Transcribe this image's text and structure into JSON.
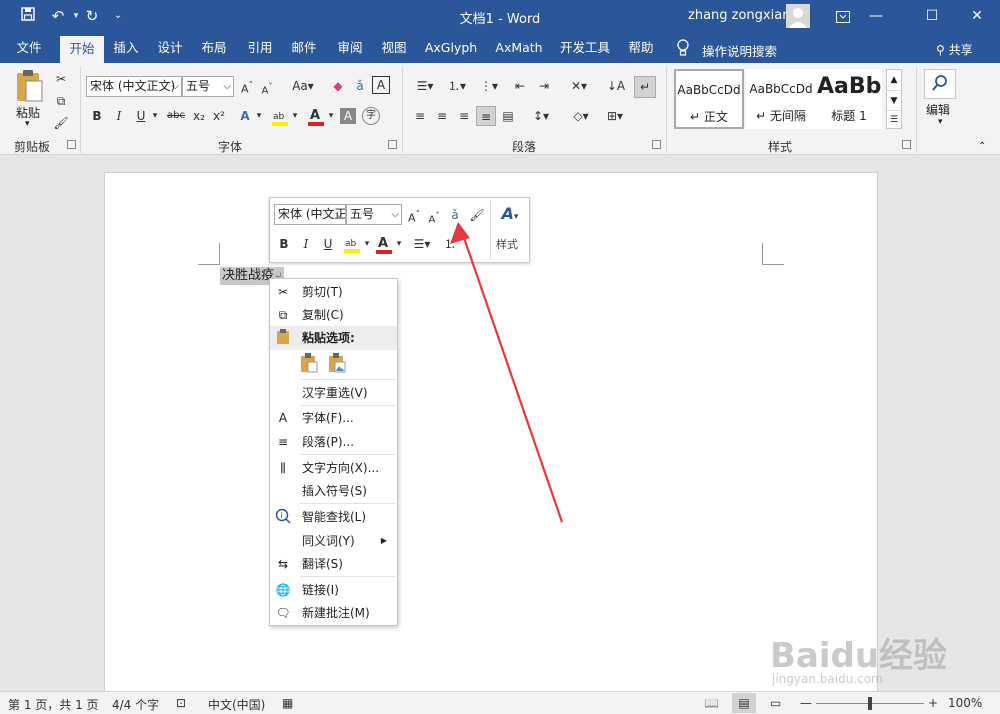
{
  "titlebar": {
    "doc_title": "文档1 - Word",
    "user_name": "zhang zongxian",
    "qa_save": "save-icon",
    "qa_undo": "undo-icon",
    "qa_redo": "redo-icon",
    "qa_more": "customize-icon"
  },
  "tabs": [
    {
      "label": "文件"
    },
    {
      "label": "开始"
    },
    {
      "label": "插入"
    },
    {
      "label": "设计"
    },
    {
      "label": "布局"
    },
    {
      "label": "引用"
    },
    {
      "label": "邮件"
    },
    {
      "label": "审阅"
    },
    {
      "label": "视图"
    },
    {
      "label": "AxGlyph"
    },
    {
      "label": "AxMath"
    },
    {
      "label": "开发工具"
    },
    {
      "label": "帮助"
    }
  ],
  "tell_me": "操作说明搜索",
  "share": "共享",
  "ribbon": {
    "clipboard": {
      "label": "剪贴板",
      "paste": "粘贴"
    },
    "font": {
      "label": "字体",
      "font_name": "宋体 (中文正文)",
      "font_size": "五号",
      "change_case": "Aa",
      "bold": "B",
      "italic": "I",
      "underline": "U",
      "strike": "abc",
      "sub": "x₂",
      "sup": "x²"
    },
    "paragraph": {
      "label": "段落"
    },
    "styles": {
      "label": "样式",
      "items": [
        {
          "sample": "AaBbCcDd",
          "name": "正文"
        },
        {
          "sample": "AaBbCcDd",
          "name": "无间隔"
        },
        {
          "sample": "AaBb",
          "name": "标题 1"
        }
      ]
    },
    "editing": {
      "label": "编辑"
    }
  },
  "document": {
    "selected_text": "决胜战疫"
  },
  "minitoolbar": {
    "font_name": "宋体 (中文正文)",
    "font_size": "五号",
    "bold": "B",
    "italic": "I",
    "underline": "U",
    "styles": "样式"
  },
  "context_menu": {
    "cut": "剪切(T)",
    "copy": "复制(C)",
    "paste_options": "粘贴选项:",
    "reconvert": "汉字重选(V)",
    "font": "字体(F)...",
    "paragraph": "段落(P)...",
    "text_direction": "文字方向(X)...",
    "insert_symbol": "插入符号(S)",
    "smart_lookup": "智能查找(L)",
    "synonyms": "同义词(Y)",
    "translate": "翻译(S)",
    "link": "链接(I)",
    "new_comment": "新建批注(M)"
  },
  "statusbar": {
    "page": "第 1 页，共 1 页",
    "words": "4/4 个字",
    "language": "中文(中国)",
    "zoom": "100%",
    "zoom_level": 1.0
  },
  "watermark": {
    "brand": "Baidu经验",
    "url": "jingyan.baidu.com"
  },
  "colors": {
    "accent": "#2b579a",
    "arrow": "#e8383d",
    "font_red": "#e02020",
    "highlight_yellow": "#ffef00"
  }
}
